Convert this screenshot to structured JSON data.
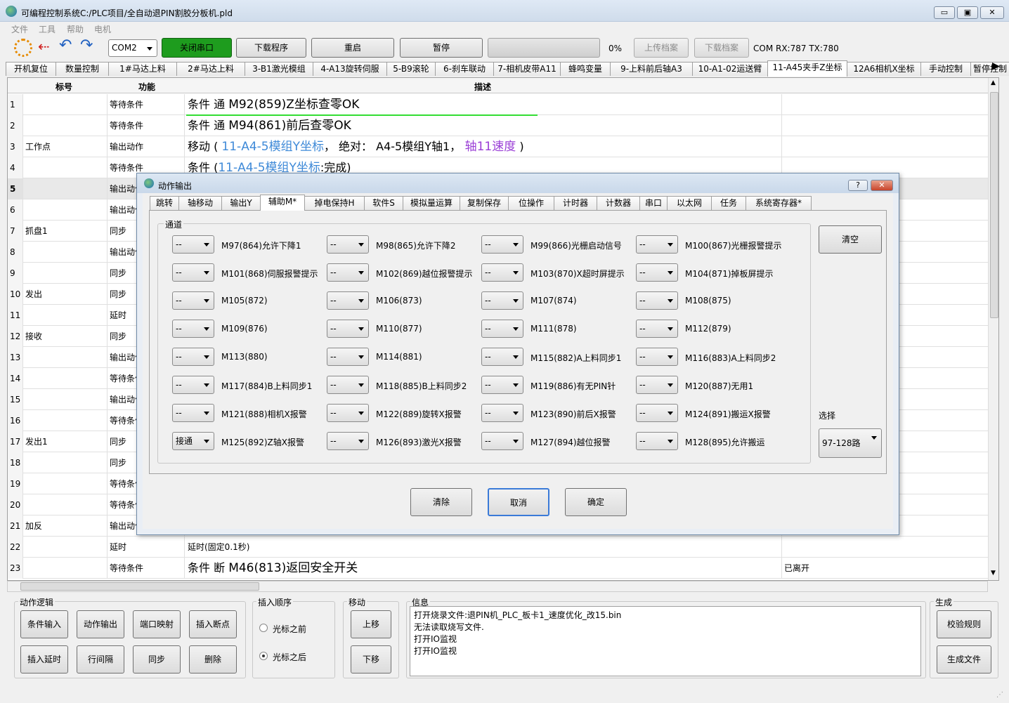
{
  "window": {
    "title": "可编程控制系统C:/PLC项目/全自动退PIN割胶分板机.pld",
    "min": "▭",
    "max": "▣",
    "close": "✕"
  },
  "menu": [
    "文件",
    "工具",
    "帮助",
    "电机"
  ],
  "toolbar": {
    "port": "COM2",
    "close_port": "关闭串口",
    "download_program": "下载程序",
    "restart": "重启",
    "pause": "暂停",
    "progress_percent": "0%",
    "progress_value": 0,
    "upload_file": "上传档案",
    "download_file": "下载档案",
    "com_status": "COM RX:787 TX:780",
    "accent_green": "#1e9c1e"
  },
  "tabs": [
    "开机复位",
    "数量控制",
    "1#马达上料",
    "2#马达上料",
    "3-B1激光模组",
    "4-A13旋转伺服",
    "5-B9滚轮",
    "6-刹车联动",
    "7-相机皮带A11",
    "蜂鸣变量",
    "9-上料前后轴A3",
    "10-A1-02运送臂",
    "11-A45夹手Z坐标",
    "12A6相机X坐标",
    "手动控制",
    "暂停控制"
  ],
  "active_tab": 12,
  "grid": {
    "headers": {
      "label": "标号",
      "func": "功能",
      "desc": "描述"
    },
    "rows": [
      {
        "n": "1",
        "label": "",
        "func": "等待条件",
        "desc": [
          [
            "条件 通 ",
            ""
          ],
          [
            "M92(859)Z坐标查零OK",
            "big"
          ]
        ],
        "extra": ""
      },
      {
        "n": "2",
        "label": "",
        "func": "等待条件",
        "desc": [
          [
            "条件 通 ",
            ""
          ],
          [
            "M94(861)前后查零OK",
            "big"
          ]
        ],
        "extra": ""
      },
      {
        "n": "3",
        "label": "工作点",
        "func": "输出动作",
        "desc": [
          [
            "移动 ( ",
            ""
          ],
          [
            "11-A4-5模组Y坐标",
            "blue"
          ],
          [
            "， 绝对： A4-5模组Y轴1，",
            ""
          ],
          [
            " 轴11速度",
            "purple"
          ],
          [
            " )",
            ""
          ]
        ],
        "extra": ""
      },
      {
        "n": "4",
        "label": "",
        "func": "等待条件",
        "desc": [
          [
            "条件 (",
            ""
          ],
          [
            "11-A4-5模组Y坐标",
            "blue"
          ],
          [
            ":完成)",
            ""
          ]
        ],
        "extra": ""
      },
      {
        "n": "5",
        "label": "",
        "func": "输出动作",
        "desc": [],
        "extra": ""
      },
      {
        "n": "6",
        "label": "",
        "func": "输出动作",
        "desc": [],
        "extra": ""
      },
      {
        "n": "7",
        "label": "抓盘1",
        "func": "同步",
        "desc": [],
        "extra": ""
      },
      {
        "n": "8",
        "label": "",
        "func": "输出动作",
        "desc": [],
        "extra": ""
      },
      {
        "n": "9",
        "label": "",
        "func": "同步",
        "desc": [],
        "extra": ""
      },
      {
        "n": "10",
        "label": "发出",
        "func": "同步",
        "desc": [],
        "extra": ""
      },
      {
        "n": "11",
        "label": "",
        "func": "延时",
        "desc": [],
        "extra": ""
      },
      {
        "n": "12",
        "label": "接收",
        "func": "同步",
        "desc": [],
        "extra": ""
      },
      {
        "n": "13",
        "label": "",
        "func": "输出动作",
        "desc": [],
        "extra": ""
      },
      {
        "n": "14",
        "label": "",
        "func": "等待条件",
        "desc": [],
        "extra": ""
      },
      {
        "n": "15",
        "label": "",
        "func": "输出动作",
        "desc": [],
        "extra": ""
      },
      {
        "n": "16",
        "label": "",
        "func": "等待条件",
        "desc": [],
        "extra": ""
      },
      {
        "n": "17",
        "label": "发出1",
        "func": "同步",
        "desc": [],
        "extra": ""
      },
      {
        "n": "18",
        "label": "",
        "func": "同步",
        "desc": [],
        "extra": ""
      },
      {
        "n": "19",
        "label": "",
        "func": "等待条件",
        "desc": [],
        "extra": ""
      },
      {
        "n": "20",
        "label": "",
        "func": "等待条件",
        "desc": [],
        "extra": ""
      },
      {
        "n": "21",
        "label": "加反",
        "func": "输出动作",
        "desc": [],
        "extra": ""
      },
      {
        "n": "22",
        "label": "",
        "func": "延时",
        "desc": [
          [
            "延时(固定0.1秒)",
            ""
          ]
        ],
        "extra": ""
      },
      {
        "n": "23",
        "label": "",
        "func": "等待条件",
        "desc": [
          [
            "条件 断 ",
            ""
          ],
          [
            "M46(813)返回安全开关",
            "big"
          ]
        ],
        "extra": "已离开"
      }
    ]
  },
  "dialog": {
    "title": "动作输出",
    "help": "?",
    "close": "✕",
    "tabs": [
      "跳转",
      "轴移动",
      "输出Y",
      "辅助M*",
      "掉电保持H",
      "软件S",
      "模拟量运算",
      "复制保存",
      "位操作",
      "计时器",
      "计数器",
      "串口",
      "以太网",
      "任务",
      "系统寄存器*"
    ],
    "active_tab": 3,
    "group_label": "通道",
    "clear_button": "清空",
    "select_label": "选择",
    "select_value": "97-128路",
    "channels": [
      {
        "v": "--",
        "l": "M97(864)允许下降1"
      },
      {
        "v": "--",
        "l": "M98(865)允许下降2"
      },
      {
        "v": "--",
        "l": "M99(866)光栅启动信号"
      },
      {
        "v": "--",
        "l": "M100(867)光栅报警提示"
      },
      {
        "v": "--",
        "l": "M101(868)伺服报警提示"
      },
      {
        "v": "--",
        "l": "M102(869)越位报警提示"
      },
      {
        "v": "--",
        "l": "M103(870)X超时屏提示"
      },
      {
        "v": "--",
        "l": "M104(871)掉板屏提示"
      },
      {
        "v": "--",
        "l": "M105(872)"
      },
      {
        "v": "--",
        "l": "M106(873)"
      },
      {
        "v": "--",
        "l": "M107(874)"
      },
      {
        "v": "--",
        "l": "M108(875)"
      },
      {
        "v": "--",
        "l": "M109(876)"
      },
      {
        "v": "--",
        "l": "M110(877)"
      },
      {
        "v": "--",
        "l": "M111(878)"
      },
      {
        "v": "--",
        "l": "M112(879)"
      },
      {
        "v": "--",
        "l": "M113(880)"
      },
      {
        "v": "--",
        "l": "M114(881)"
      },
      {
        "v": "--",
        "l": "M115(882)A上料同步1"
      },
      {
        "v": "--",
        "l": "M116(883)A上料同步2"
      },
      {
        "v": "--",
        "l": "M117(884)B上料同步1"
      },
      {
        "v": "--",
        "l": "M118(885)B上料同步2"
      },
      {
        "v": "--",
        "l": "M119(886)有无PIN针"
      },
      {
        "v": "--",
        "l": "M120(887)无用1"
      },
      {
        "v": "--",
        "l": "M121(888)相机X报警"
      },
      {
        "v": "--",
        "l": "M122(889)旋转X报警"
      },
      {
        "v": "--",
        "l": "M123(890)前后X报警"
      },
      {
        "v": "--",
        "l": "M124(891)搬运X报警"
      },
      {
        "v": "接通",
        "l": "M125(892)Z轴X报警"
      },
      {
        "v": "--",
        "l": "M126(893)激光X报警"
      },
      {
        "v": "--",
        "l": "M127(894)越位报警"
      },
      {
        "v": "--",
        "l": "M128(895)允许搬运"
      }
    ],
    "buttons": {
      "clear": "清除",
      "cancel": "取消",
      "ok": "确定"
    }
  },
  "bottom": {
    "logic_label": "动作逻辑",
    "logic_buttons": [
      "条件输入",
      "动作输出",
      "端口映射",
      "插入断点",
      "插入延时",
      "行间隔",
      "同步",
      "删除"
    ],
    "order_label": "插入顺序",
    "order_options": [
      "光标之前",
      "光标之后"
    ],
    "order_selected": 1,
    "move_label": "移动",
    "move_up": "上移",
    "move_down": "下移",
    "info_label": "信息",
    "info_lines": [
      "打开烧录文件:退PIN机_PLC_板卡1_速度优化_改15.bin",
      "无法读取烧写文件.",
      "打开IO监视",
      "打开IO监视"
    ],
    "gen_label": "生成",
    "check_rules": "校验规则",
    "gen_file": "生成文件"
  }
}
